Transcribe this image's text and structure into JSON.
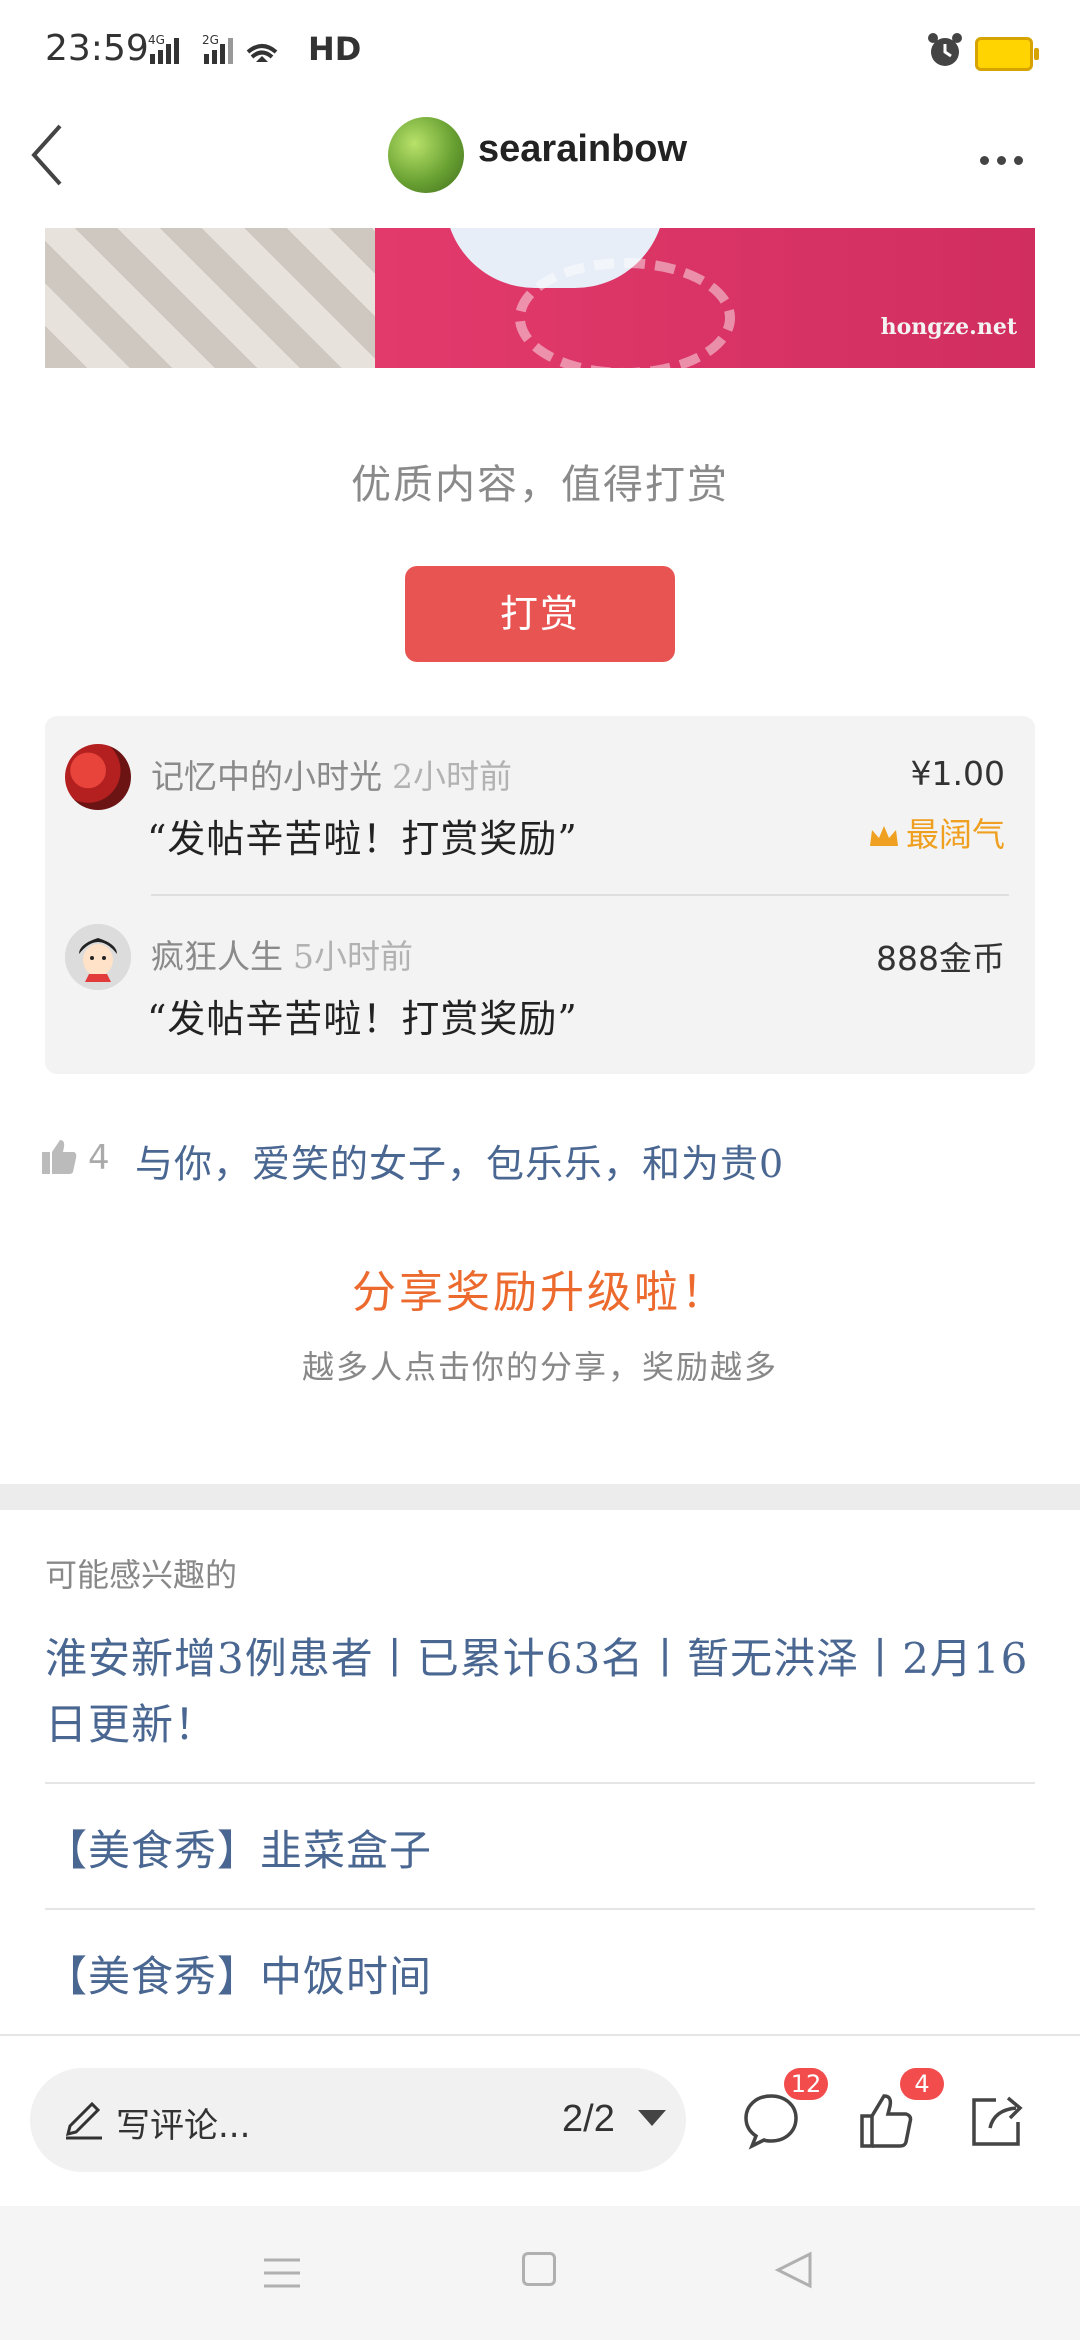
{
  "status_bar": {
    "time": "23:59",
    "network": "HD",
    "icons": [
      "signal-4g-icon",
      "signal-2g-icon",
      "wifi-icon",
      "alarm-icon",
      "battery-icon"
    ]
  },
  "header": {
    "username": "searainbow",
    "icons": [
      "back-icon",
      "avatar",
      "more-icon"
    ]
  },
  "image": {
    "watermark": "hongze.net"
  },
  "reward": {
    "prompt": "优质内容，值得打赏",
    "button_label": "打赏",
    "tips": [
      {
        "name": "记忆中的小时光",
        "time": "2小时前",
        "message": "“发帖辛苦啦！打赏奖励”",
        "amount": "¥1.00",
        "badge": "最阔气"
      },
      {
        "name": "疯狂人生",
        "time": "5小时前",
        "message": "“发帖辛苦啦！打赏奖励”",
        "amount": "888金币"
      }
    ]
  },
  "likes": {
    "count": "4",
    "names": "与你，爱笑的女子，包乐乐，和为贵0"
  },
  "share_promo": {
    "title": "分享奖励升级啦！",
    "subtitle": "越多人点击你的分享，奖励越多"
  },
  "recommendations": {
    "header": "可能感兴趣的",
    "items": [
      "淮安新增3例患者丨已累计63名丨暂无洪泽丨2月16日更新！",
      "【美食秀】韭菜盒子",
      "【美食秀】中饭时间"
    ]
  },
  "action_bar": {
    "comment_placeholder": "写评论...",
    "page_indicator": "2/2",
    "comment_count": "12",
    "like_count": "4"
  },
  "colors": {
    "reward_button": "#e85452",
    "link_blue": "#4a6792",
    "share_orange": "#ec6a2e",
    "badge_gold": "#f0a020",
    "badge_red": "#f24c4c"
  }
}
